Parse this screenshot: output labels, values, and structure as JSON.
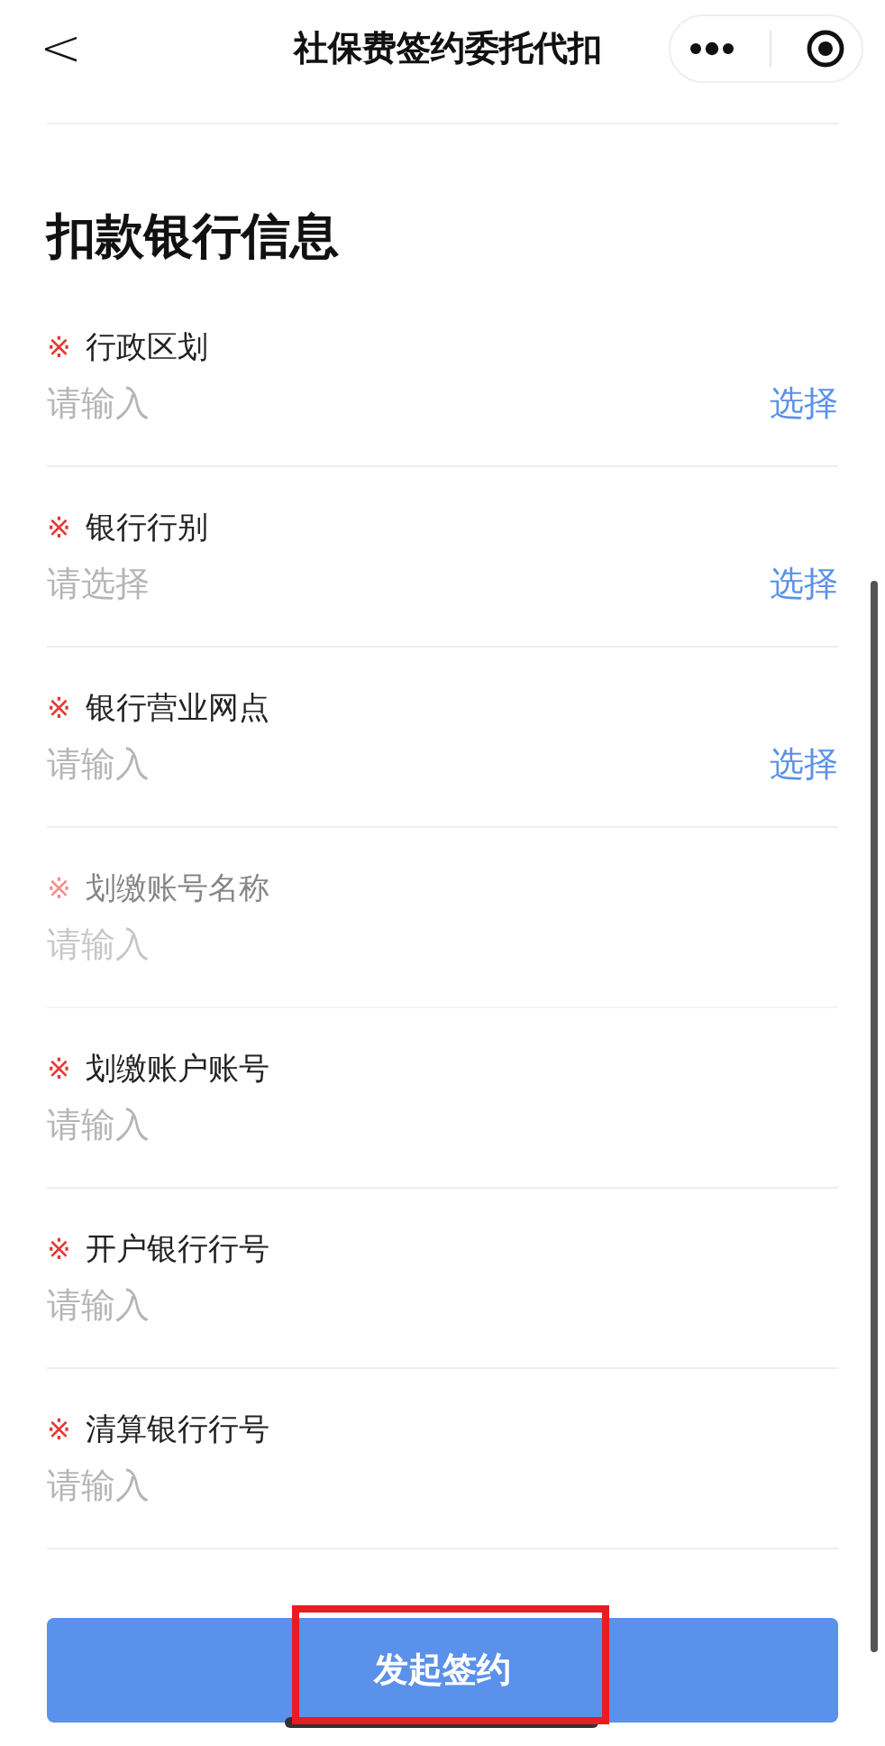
{
  "nav": {
    "back": "<",
    "title": "社保费签约委托代扣"
  },
  "section_title": "扣款银行信息",
  "fields": [
    {
      "mark": "※",
      "label": "行政区划",
      "placeholder": "请输入",
      "action": "选择",
      "disabled": false
    },
    {
      "mark": "※",
      "label": "银行行别",
      "placeholder": "请选择",
      "action": "选择",
      "disabled": false
    },
    {
      "mark": "※",
      "label": "银行营业网点",
      "placeholder": "请输入",
      "action": "选择",
      "disabled": false
    },
    {
      "mark": "※",
      "label": "划缴账号名称",
      "placeholder": "请输入",
      "disabled": true
    },
    {
      "mark": "※",
      "label": "划缴账户账号",
      "placeholder": "请输入",
      "disabled": false
    },
    {
      "mark": "※",
      "label": "开户银行行号",
      "placeholder": "请输入",
      "disabled": false
    },
    {
      "mark": "※",
      "label": "清算银行行号",
      "placeholder": "请输入",
      "disabled": false
    }
  ],
  "submit": {
    "label": "发起签约",
    "highlighted": true
  }
}
